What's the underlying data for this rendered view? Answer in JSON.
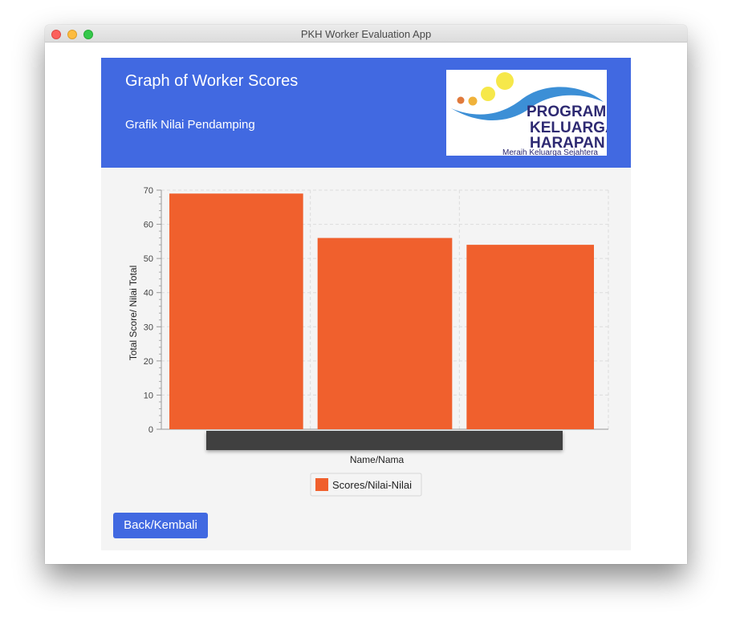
{
  "window": {
    "title": "PKH Worker Evaluation App"
  },
  "header": {
    "title": "Graph of Worker Scores",
    "subtitle": "Grafik Nilai Pendamping",
    "logo_text": [
      "PROGRAM",
      "KELUARGA",
      "HARAPAN",
      "Meraih Keluarga Sejahtera"
    ]
  },
  "buttons": {
    "back": "Back/Kembali"
  },
  "colors": {
    "header_bg": "#4169e1",
    "bar": "#f0602d",
    "tooltip": "#404040",
    "logo_navy": "#2e2a72",
    "logo_blue": "#3c8fd6",
    "logo_yellow": "#f6e84a"
  },
  "chart_data": {
    "type": "bar",
    "categories": [
      "",
      "",
      ""
    ],
    "series": [
      {
        "name": "Scores/Nilai-Nilai",
        "values": [
          69,
          56,
          54
        ]
      }
    ],
    "xlabel": "Name/Nama",
    "ylabel": "Total Score/ Nilai Total",
    "ylim": [
      0,
      70
    ],
    "yticks": [
      0,
      10,
      20,
      30,
      40,
      50,
      60,
      70
    ],
    "grid": true,
    "legend": "bottom-center",
    "hover_tooltip_visible": true
  }
}
